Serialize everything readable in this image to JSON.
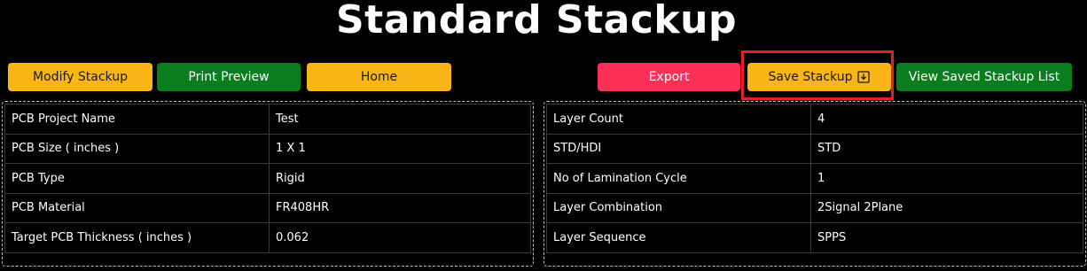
{
  "page": {
    "title": "Standard Stackup"
  },
  "toolbar": {
    "modify_label": "Modify Stackup",
    "print_preview_label": "Print Preview",
    "home_label": "Home",
    "export_label": "Export",
    "save_label": "Save Stackup",
    "save_icon": "download-icon",
    "view_saved_label": "View Saved Stackup List"
  },
  "project_info": {
    "rows": [
      {
        "label": "PCB Project Name",
        "value": "Test"
      },
      {
        "label": "PCB Size ( inches )",
        "value": "1 X 1"
      },
      {
        "label": "PCB Type",
        "value": "Rigid"
      },
      {
        "label": "PCB Material",
        "value": "FR408HR"
      },
      {
        "label": "Target PCB Thickness ( inches )",
        "value": "0.062"
      }
    ]
  },
  "layer_info": {
    "rows": [
      {
        "label": "Layer Count",
        "value": "4"
      },
      {
        "label": "STD/HDI",
        "value": "STD"
      },
      {
        "label": "No of Lamination Cycle",
        "value": "1"
      },
      {
        "label": "Layer Combination",
        "value": "2Signal 2Plane"
      },
      {
        "label": "Layer Sequence",
        "value": "SPPS"
      }
    ]
  },
  "colors": {
    "background": "#000000",
    "yellow_button": "#fbb517",
    "green_button": "#0a7e1e",
    "red_button": "#fd3058",
    "highlight_border": "#e0202a"
  }
}
